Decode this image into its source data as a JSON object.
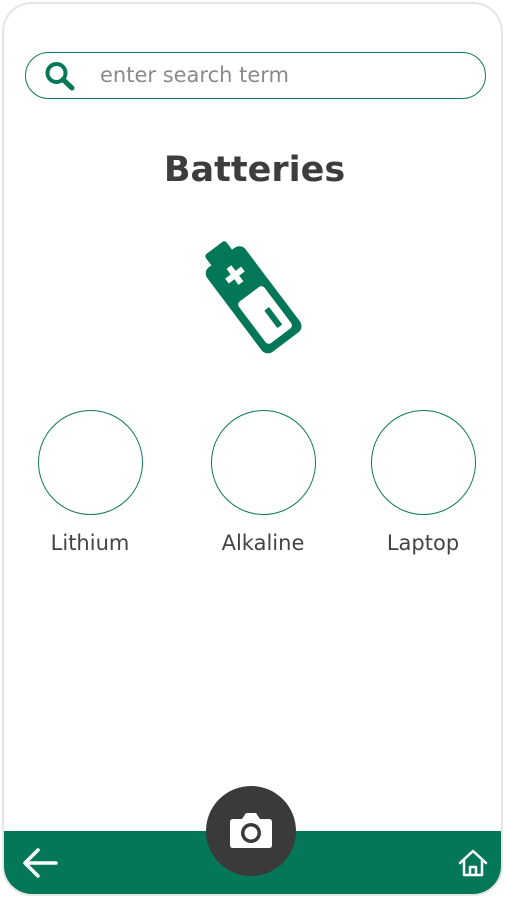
{
  "search": {
    "placeholder": "enter search term",
    "icon": "search-icon"
  },
  "page": {
    "title": "Batteries",
    "illustration_icon": "battery-icon"
  },
  "categories": [
    {
      "label": "Lithium"
    },
    {
      "label": "Alkaline"
    },
    {
      "label": "Laptop"
    }
  ],
  "bottom_bar": {
    "back_icon": "arrow-left-icon",
    "home_icon": "home-icon",
    "camera_icon": "camera-icon"
  },
  "colors": {
    "brand_green": "#037757",
    "outline_green": "#117a5a",
    "camera_button": "#3a3a3a",
    "title_text": "#3d3d3d"
  }
}
